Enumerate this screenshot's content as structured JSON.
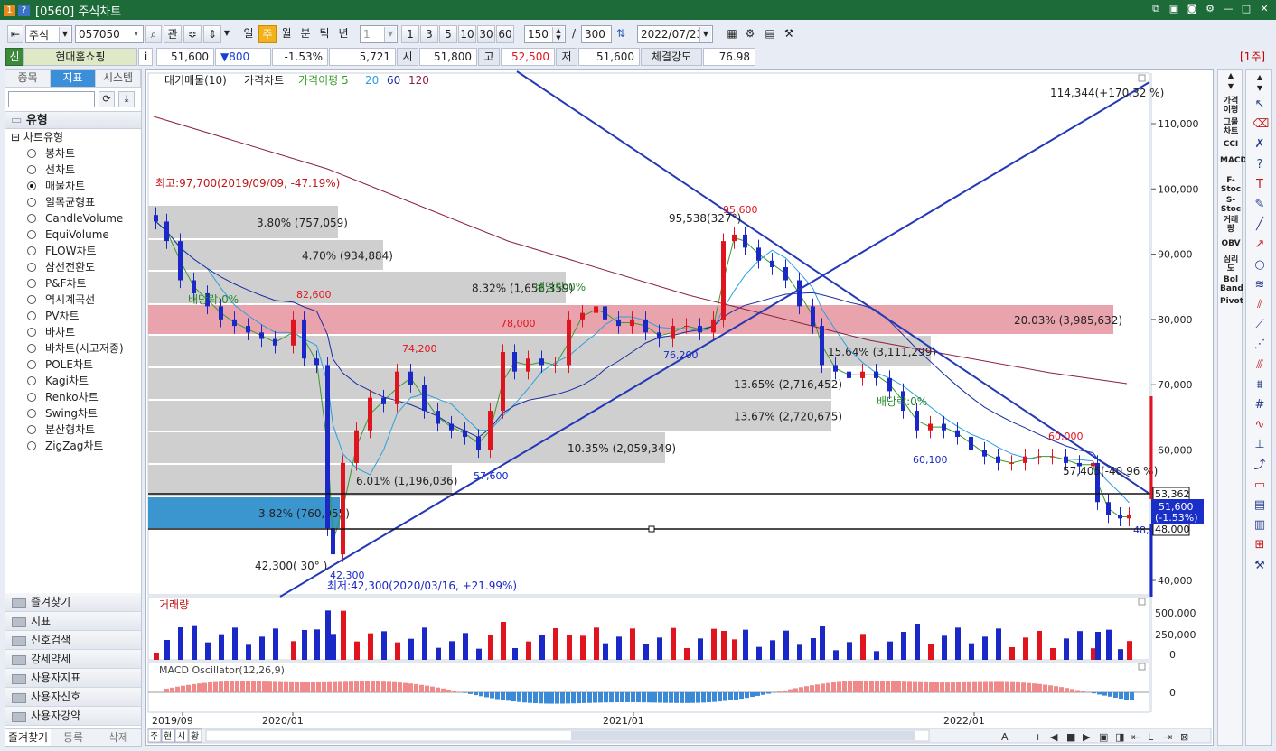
{
  "window": {
    "badge1": "1",
    "badge2": "?",
    "title": "[0560] 주식차트"
  },
  "toolbar": {
    "market": "주식",
    "code": "057050",
    "btn_gwan": "관",
    "periods": [
      "일",
      "주",
      "월",
      "분",
      "틱",
      "년"
    ],
    "selected_period": "주",
    "unit_value": "1",
    "quick_units": [
      "1",
      "3",
      "5",
      "10",
      "30",
      "60"
    ],
    "count": "150",
    "slash": "/",
    "total": "300",
    "date": "2022/07/23"
  },
  "quote": {
    "tag": "신",
    "name": "현대홈쇼핑",
    "info": "i",
    "price": "51,600",
    "change": "▼800",
    "change_pct": "-1.53%",
    "volume": "5,721",
    "open_label": "시",
    "open": "51,800",
    "high_label": "고",
    "high": "52,500",
    "low_label": "저",
    "low": "51,600",
    "strength_label": "체결강도",
    "strength": "76.98",
    "period_tag": "[1주]"
  },
  "left_panel": {
    "tabs": [
      "종목",
      "지표",
      "시스템"
    ],
    "active_tab": "지표",
    "group_header": "유형",
    "tree_root": "차트유형",
    "chart_types": [
      "봉차트",
      "선차트",
      "매물차트",
      "일목균형표",
      "CandleVolume",
      "EquiVolume",
      "FLOW차트",
      "삼선전환도",
      "P&F차트",
      "역시계곡선",
      "PV차트",
      "바차트",
      "바차트(시고저종)",
      "POLE차트",
      "Kagi차트",
      "Renko차트",
      "Swing차트",
      "분산형차트",
      "ZigZag차트"
    ],
    "selected_type": "매물차트",
    "bottom_groups": [
      "즐겨찾기",
      "지표",
      "신호검색",
      "강세약세",
      "사용자지표",
      "사용자신호",
      "사용자강약"
    ],
    "bottom_tabs": [
      "즐겨찾기",
      "등록",
      "삭제"
    ]
  },
  "chart": {
    "legend": {
      "item1": "대기매물(10)",
      "item2": "가격차트",
      "item3": "가격이평 5",
      "ma20": "20",
      "ma60": "60",
      "ma120": "120"
    },
    "y_ticks": [
      "110,000",
      "100,000",
      "90,000",
      "80,000",
      "70,000",
      "60,000",
      "50,000",
      "40,000"
    ],
    "x_ticks": [
      "2019/09",
      "2020/01",
      "2021/01",
      "2022/01"
    ],
    "annotations": {
      "top_right": "114,344(+170.32 %)",
      "high": "최고:97,700(2019/09/09, -47.19%)",
      "low": "최저:42,300(2020/03/16, +21.99%)",
      "p82600": "82,600",
      "p74200": "74,200",
      "p78000": "78,000",
      "p95600": "95,600",
      "p95538": "95,538(327°)",
      "p76200": "76,200",
      "p57600": "57,600",
      "p42300": "42,300",
      "p42300b": "42,300( 30° )",
      "p60100": "60,100",
      "p60000": "60,000",
      "p57405": "57,405(-40.96 %)",
      "p53362": "53,362",
      "p51600": "51,600",
      "p51600pct": "(-1.53%)",
      "p48000": "48,000",
      "p48650": "48,650",
      "div1": "배당락:0%",
      "div2": "배당락:0%",
      "div3": "배당락:0%"
    },
    "profile_bars": [
      {
        "label": "3.80% (757,059)"
      },
      {
        "label": "4.70% (934,884)"
      },
      {
        "label": "8.32% (1,656,359)"
      },
      {
        "label": "20.03% (3,985,632)"
      },
      {
        "label": "15.64% (3,111,299)"
      },
      {
        "label": "13.65% (2,716,452)"
      },
      {
        "label": "13.67% (2,720,675)"
      },
      {
        "label": "10.35% (2,059,349)"
      },
      {
        "label": "6.01% (1,196,036)"
      },
      {
        "label": "3.82% (760,955)"
      }
    ],
    "volume_title": "거래량",
    "volume_ticks": [
      "500,000",
      "250,000",
      "0"
    ],
    "macd_title": "MACD Oscillator(12,26,9)",
    "macd_tick": "0",
    "bottom_buttons": [
      "주",
      "현",
      "시",
      "황"
    ]
  },
  "right_tools": [
    "가격이평",
    "그물차트",
    "CCI",
    "MACD",
    "F-Stoc",
    "S-Stoc",
    "거래량",
    "OBV",
    "심리도",
    "Bol Band",
    "Pivot"
  ],
  "colors": {
    "up": "#e0141e",
    "down": "#1a28c8",
    "profile": "#cfcfcf",
    "profile_max": "#e8a3ac",
    "profile_cur": "#3b95cf",
    "trend": "#2439b8"
  }
}
